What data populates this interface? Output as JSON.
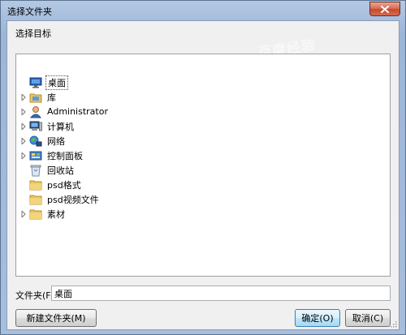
{
  "window": {
    "title": "选择文件夹"
  },
  "dialog": {
    "instruction": "选择目标",
    "watermark": "百度经验"
  },
  "tree": {
    "items": [
      {
        "label": "桌面",
        "icon": "desktop-icon",
        "expandable": false
      },
      {
        "label": "库",
        "icon": "library-icon",
        "expandable": true
      },
      {
        "label": "Administrator",
        "icon": "user-icon",
        "expandable": true
      },
      {
        "label": "计算机",
        "icon": "computer-icon",
        "expandable": true
      },
      {
        "label": "网络",
        "icon": "network-icon",
        "expandable": true
      },
      {
        "label": "控制面板",
        "icon": "control-panel-icon",
        "expandable": true
      },
      {
        "label": "回收站",
        "icon": "recycle-bin-icon",
        "expandable": false
      },
      {
        "label": "psd格式",
        "icon": "folder-icon",
        "expandable": false
      },
      {
        "label": "psd视频文件",
        "icon": "folder-icon",
        "expandable": false
      },
      {
        "label": "素材",
        "icon": "folder-icon",
        "expandable": true
      }
    ]
  },
  "folder": {
    "label": "文件夹(F):",
    "value": "桌面"
  },
  "buttons": {
    "new_folder": "新建文件夹(M)",
    "ok": "确定(O)",
    "cancel": "取消(C)"
  }
}
